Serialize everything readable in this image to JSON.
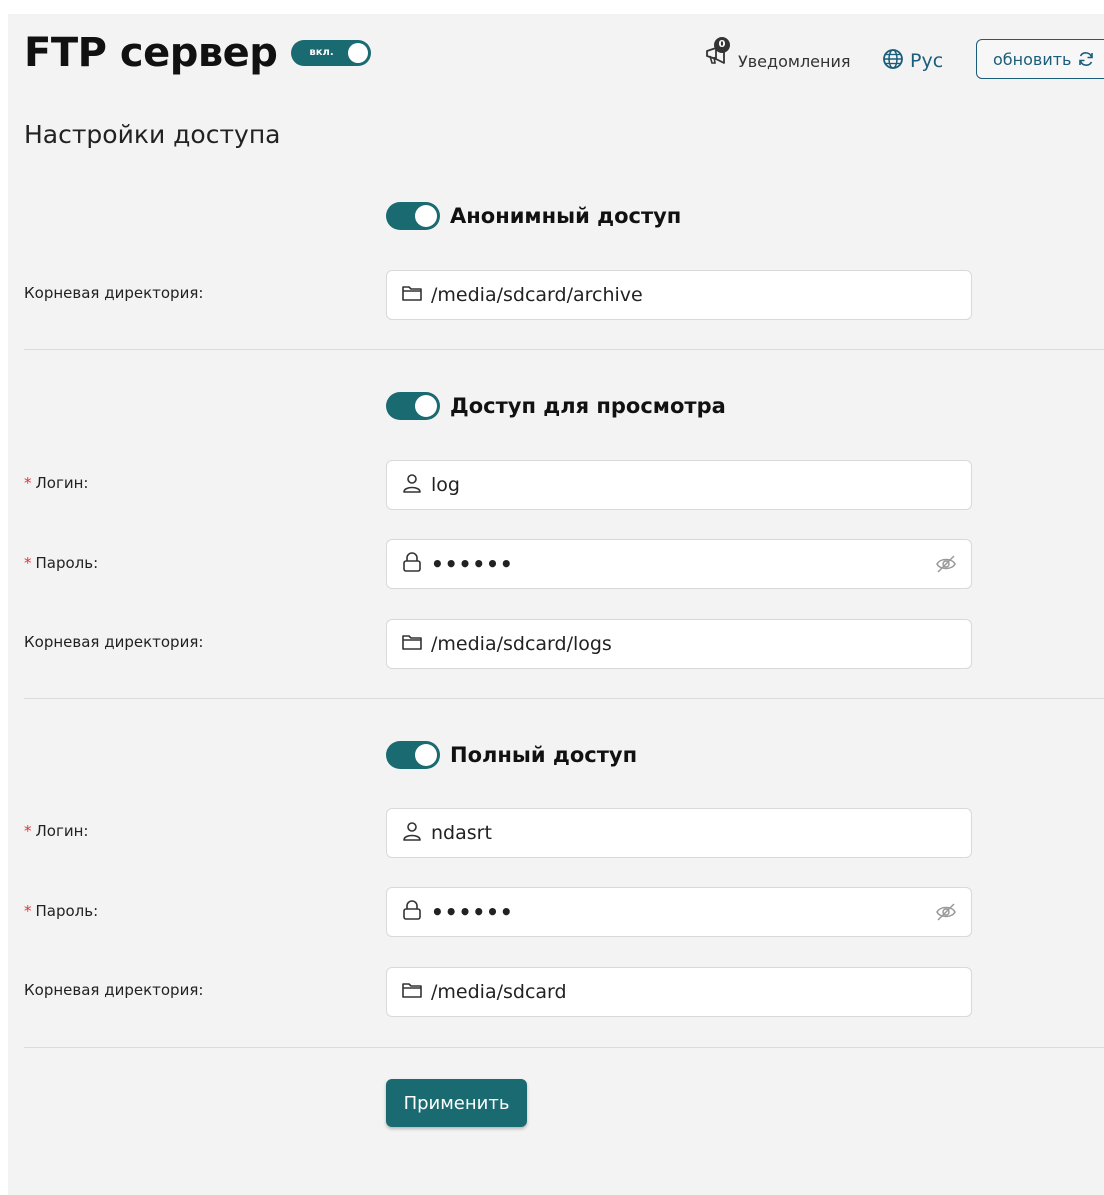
{
  "header": {
    "title": "FTP сервер",
    "main_toggle_label": "вкл.",
    "notifications_label": "Уведомления",
    "notifications_count": "0",
    "language_label": "Рус",
    "refresh_label": "обновить"
  },
  "subtitle": "Настройки доступа",
  "anonymous": {
    "title": "Анонимный доступ",
    "root_label": "Корневая директория:",
    "root_value": "/media/sdcard/archive"
  },
  "view": {
    "title": "Доступ для просмотра",
    "login_label": "Логин:",
    "login_value": "log",
    "password_label": "Пароль:",
    "password_value": "••••••",
    "root_label": "Корневая директория:",
    "root_value": "/media/sdcard/logs"
  },
  "full": {
    "title": "Полный доступ",
    "login_label": "Логин:",
    "login_value": "ndasrt",
    "password_label": "Пароль:",
    "password_value": "••••••",
    "root_label": "Корневая директория:",
    "root_value": "/media/sdcard"
  },
  "required_mark": "*",
  "apply_label": "Применить",
  "colors": {
    "accent": "#1a6a71",
    "link": "#1a5d7a",
    "required": "#d9363e"
  }
}
